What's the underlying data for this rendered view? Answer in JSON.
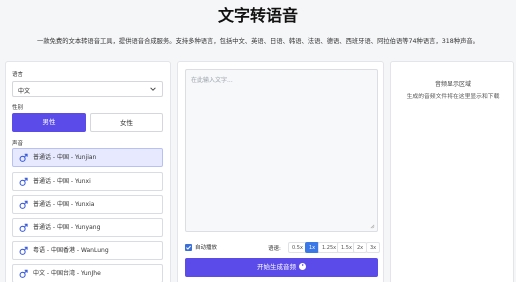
{
  "header": {
    "title": "文字转语音",
    "subtitle": "一款免费的文本转语音工具，提供语音合成服务。支持多种语言，包括中文、英语、日语、韩语、法语、德语、西班牙语、阿拉伯语等74种语言，318种声音。"
  },
  "left": {
    "language_label": "语言",
    "language_value": "中文",
    "gender_label": "性别",
    "gender_male": "男性",
    "gender_female": "女性",
    "voice_label": "声音",
    "voices": [
      "普通话 - 中国 - Yunjian",
      "普通话 - 中国 - Yunxi",
      "普通话 - 中国 - Yunxia",
      "普通话 - 中国 - Yunyang",
      "粤语 - 中国香港 - WanLung",
      "中文 - 中国台湾 - YunJhe"
    ],
    "selected_voice_index": 0
  },
  "center": {
    "text_placeholder": "在此输入文字...",
    "autoplay_label": "自动播放",
    "autoplay_checked": true,
    "speed_label": "语速:",
    "speeds": [
      "0.5x",
      "1x",
      "1.25x",
      "1.5x",
      "2x",
      "3x"
    ],
    "selected_speed": "1x",
    "generate_label": "开始生成音频"
  },
  "right": {
    "title": "音频显示区域",
    "hint": "生成的音频文件将在这里显示和下载"
  },
  "colors": {
    "accent": "#5b4be8",
    "speed_active": "#3b78e7",
    "voice_selected_bg": "#e7eaff",
    "voice_icon": "#3b5bdb"
  },
  "icons": {
    "dropdown": "chevron-down-icon",
    "voice": "male-symbol-icon",
    "generate": "play-circle-icon",
    "autoplay": "checkbox-checked-icon"
  }
}
